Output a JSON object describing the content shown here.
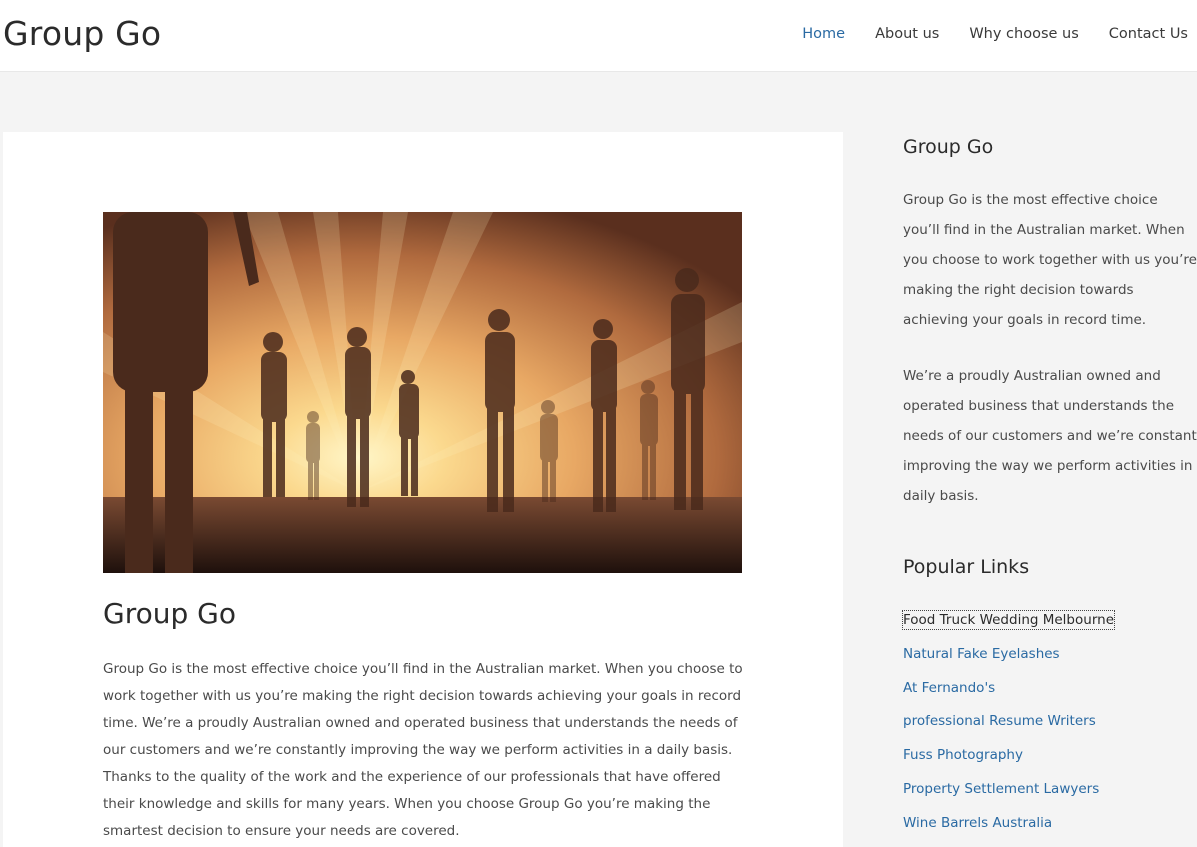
{
  "header": {
    "site_title": "Group Go",
    "nav": [
      {
        "label": "Home",
        "active": true
      },
      {
        "label": "About us",
        "active": false
      },
      {
        "label": "Why choose us",
        "active": false
      },
      {
        "label": "Contact Us",
        "active": false
      }
    ]
  },
  "main": {
    "title": "Group Go",
    "body": "Group Go is the most effective choice you’ll find in the Australian market. When you choose to work together with us you’re making the right decision towards achieving your goals in record time. We’re a proudly Australian owned and operated business that understands the needs of our customers and we’re constantly improving the way we perform activities in a daily basis. Thanks to the quality of the work and the experience of our professionals that have offered their knowledge and skills for many years. When you choose Group Go you’re making the smartest decision to ensure your needs are covered."
  },
  "sidebar": {
    "about": {
      "title": "Group Go",
      "p1": "Group Go is the most effective choice you’ll find in the Australian market. When you choose to work together with us you’re making the right decision towards achieving your goals in record time.",
      "p2_lines": [
        "We’re a proudly Australian owned and",
        "operated business that understands the",
        "needs of our customers and we’re constantly",
        "improving the way we perform activities in a",
        "daily basis."
      ]
    },
    "popular": {
      "title": "Popular Links",
      "links": [
        "Food Truck Wedding Melbourne",
        "Natural Fake Eyelashes",
        "At Fernando's",
        "professional Resume Writers",
        "Fuss Photography",
        "Property Settlement Lawyers",
        "Wine Barrels Australia"
      ]
    }
  },
  "colors": {
    "link": "#2a6aa3",
    "page_bg": "#f4f4f4",
    "card_bg": "#ffffff"
  }
}
